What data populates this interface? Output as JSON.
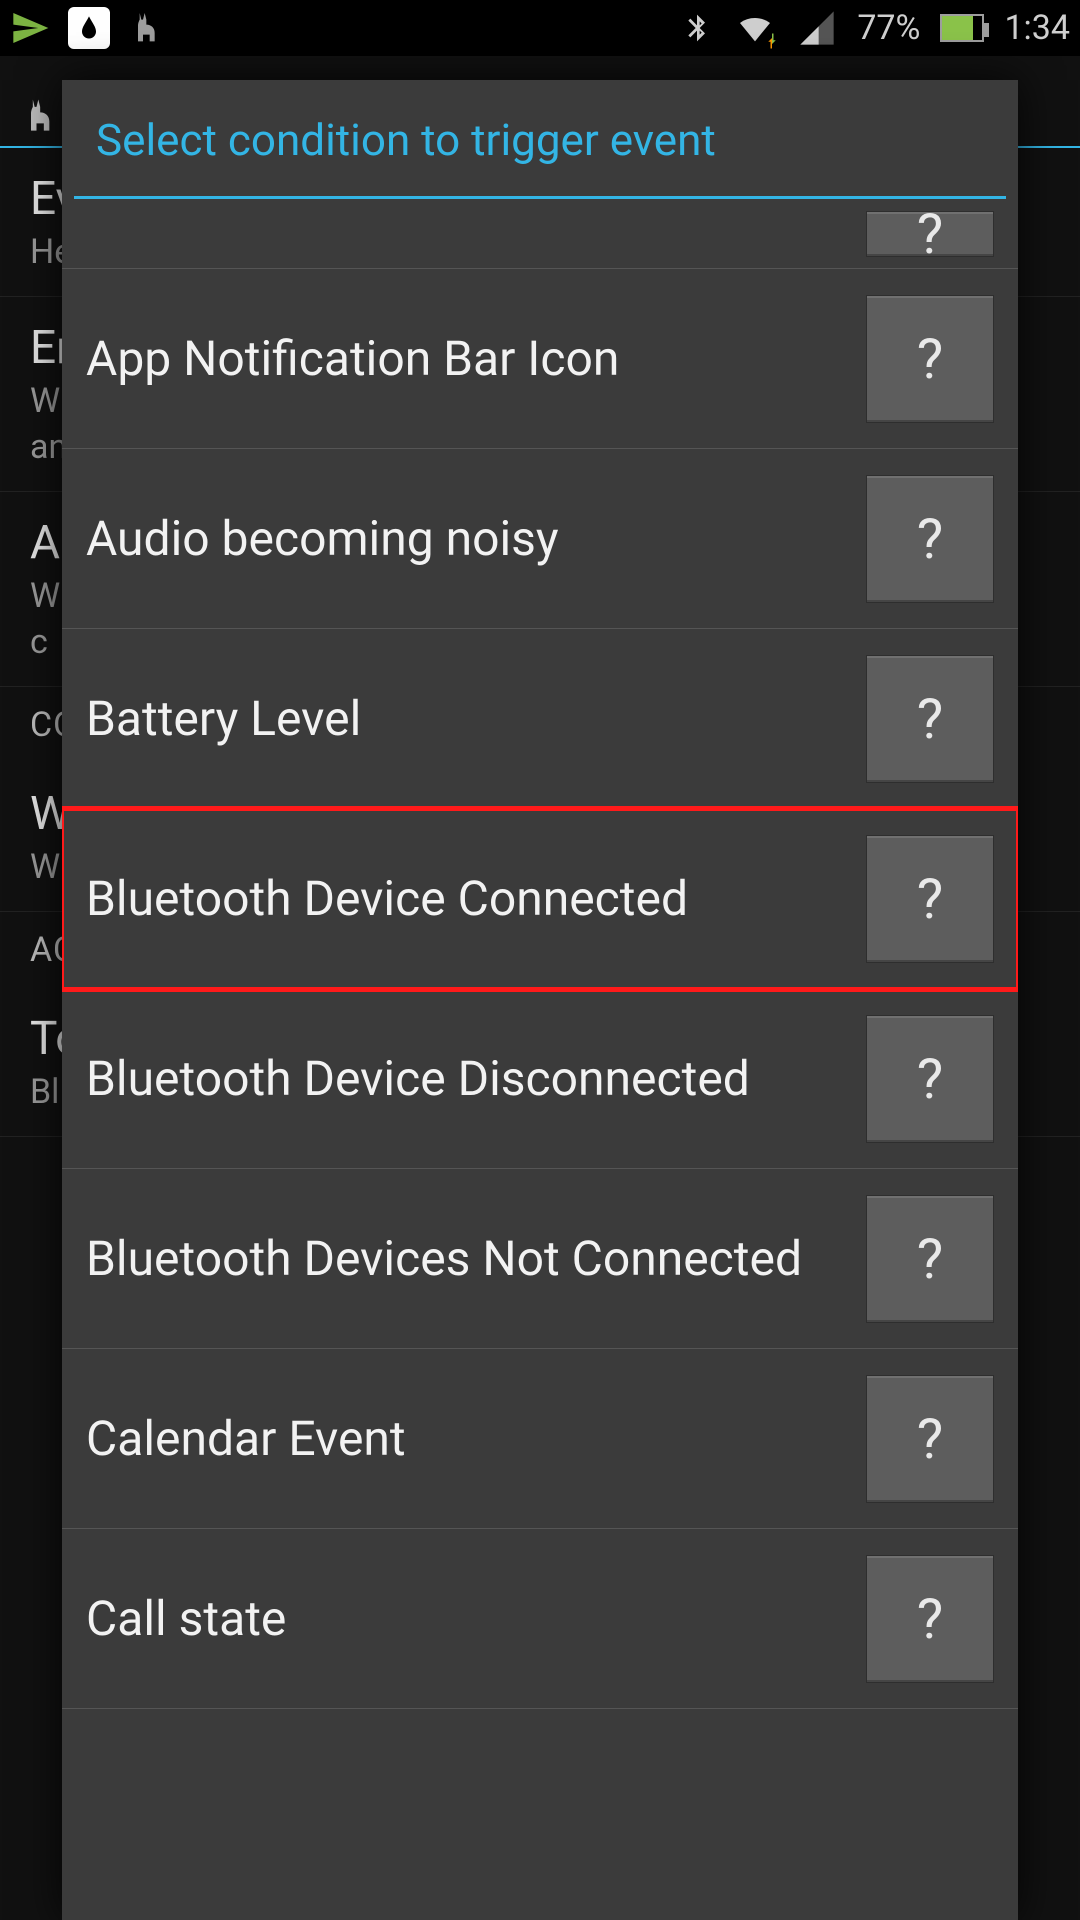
{
  "statusbar": {
    "battery_pct": "77%",
    "time": "1:34"
  },
  "background": {
    "events_title": "Ev",
    "events_sub": "He",
    "en_title": "En",
    "en_sub1": "Wh",
    "en_sub2": "and",
    "a_title": "A",
    "a_sub1": "W",
    "a_sub2": "c",
    "cond_header": "CO",
    "wi_title": "Wi",
    "wi_sub": "Wi",
    "act_header": "AC",
    "to_title": "To",
    "to_sub": "Bl"
  },
  "dialog": {
    "title": "Select condition to trigger event",
    "help_glyph": "?",
    "items": [
      {
        "label": "",
        "partial": true
      },
      {
        "label": "App Notification Bar Icon"
      },
      {
        "label": "Audio becoming noisy"
      },
      {
        "label": "Battery Level"
      },
      {
        "label": "Bluetooth Device Connected",
        "highlighted": true
      },
      {
        "label": "Bluetooth Device Disconnected"
      },
      {
        "label": "Bluetooth Devices Not Connected"
      },
      {
        "label": "Calendar Event"
      },
      {
        "label": "Call state"
      }
    ]
  }
}
